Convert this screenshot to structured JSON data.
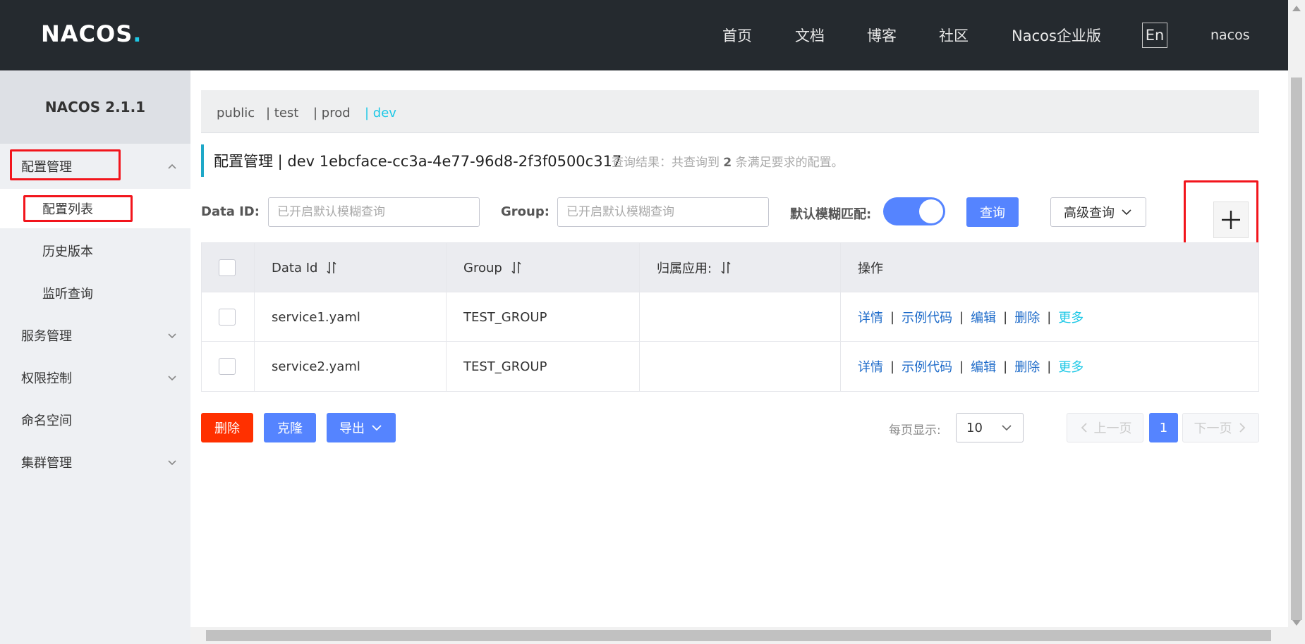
{
  "header": {
    "logo_text": "NACOS",
    "logo_dot": ".",
    "nav": [
      "首页",
      "文档",
      "博客",
      "社区",
      "Nacos企业版"
    ],
    "lang_button": "En",
    "user": "nacos"
  },
  "sidebar": {
    "version": "NACOS 2.1.1",
    "items": [
      {
        "label": "配置管理",
        "expanded": true
      },
      {
        "label": "配置列表",
        "active": true
      },
      {
        "label": "历史版本"
      },
      {
        "label": "监听查询"
      },
      {
        "label": "服务管理"
      },
      {
        "label": "权限控制"
      },
      {
        "label": "命名空间"
      },
      {
        "label": "集群管理"
      }
    ]
  },
  "namespaces": {
    "items": [
      "public",
      "| test",
      "| prod",
      "| dev"
    ],
    "current": "dev"
  },
  "title": {
    "main": "配置管理 | dev 1ebcface-cc3a-4e77-96d8-2f3f0500c317",
    "result_prefix": "查询结果：共查询到",
    "result_count": "2",
    "result_suffix": "条满足要求的配置。"
  },
  "query": {
    "dataid_label": "Data ID:",
    "dataid_placeholder": "已开启默认模糊查询",
    "group_label": "Group:",
    "group_placeholder": "已开启默认模糊查询",
    "fuzzy_label": "默认模糊匹配:",
    "fuzzy_on": true,
    "search_button": "查询",
    "advanced_button": "高级查询"
  },
  "table": {
    "headers": [
      "Data Id",
      "Group",
      "归属应用:",
      "操作"
    ],
    "rows": [
      {
        "data_id": "service1.yaml",
        "group": "TEST_GROUP",
        "app": ""
      },
      {
        "data_id": "service2.yaml",
        "group": "TEST_GROUP",
        "app": ""
      }
    ],
    "ops": [
      "详情",
      "示例代码",
      "编辑",
      "删除",
      "更多"
    ]
  },
  "footer": {
    "delete_button": "删除",
    "clone_button": "克隆",
    "export_button": "导出",
    "page_size_label": "每页显示:",
    "page_size": "10",
    "prev_button": "上一页",
    "current_page": "1",
    "next_button": "下一页"
  },
  "colors": {
    "header_bg": "#252a2f",
    "accent": "#1ec8e6",
    "primary": "#5584ff",
    "danger": "#ff3000",
    "highlight_box": "#f2151c"
  }
}
